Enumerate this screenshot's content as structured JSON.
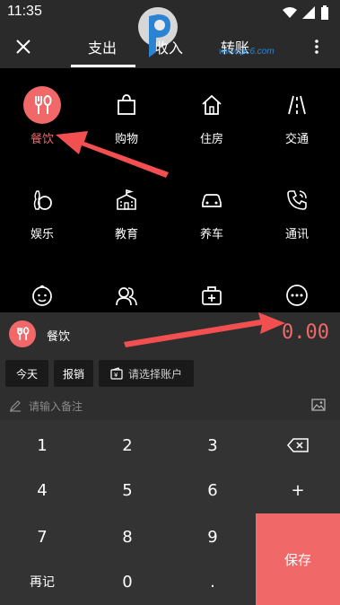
{
  "status": {
    "time": "11:35"
  },
  "header": {
    "tabs": [
      {
        "label": "支出",
        "active": true
      },
      {
        "label": "收入",
        "active": false
      },
      {
        "label": "转账",
        "active": false
      }
    ]
  },
  "watermark": {
    "text": "www.pc6.com"
  },
  "categories": [
    {
      "label": "餐饮",
      "icon": "fork-spoon-icon",
      "selected": true
    },
    {
      "label": "购物",
      "icon": "shopping-bag-icon",
      "selected": false
    },
    {
      "label": "住房",
      "icon": "house-icon",
      "selected": false
    },
    {
      "label": "交通",
      "icon": "road-icon",
      "selected": false
    },
    {
      "label": "娱乐",
      "icon": "bowling-icon",
      "selected": false
    },
    {
      "label": "教育",
      "icon": "school-icon",
      "selected": false
    },
    {
      "label": "养车",
      "icon": "car-icon",
      "selected": false
    },
    {
      "label": "通讯",
      "icon": "phone-icon",
      "selected": false
    },
    {
      "label": "",
      "icon": "baby-icon",
      "selected": false
    },
    {
      "label": "",
      "icon": "people-icon",
      "selected": false
    },
    {
      "label": "",
      "icon": "medical-kit-icon",
      "selected": false
    },
    {
      "label": "",
      "icon": "more-dots-icon",
      "selected": false
    }
  ],
  "entry": {
    "category": "餐饮",
    "amount": "0.00",
    "chips": {
      "date": "今天",
      "reimburse": "报销",
      "account": "请选择账户"
    },
    "note_placeholder": "请输入备注"
  },
  "keypad": {
    "keys": [
      "1",
      "2",
      "3",
      "4",
      "5",
      "6",
      "+",
      "7",
      "8",
      "9",
      "再记",
      "0",
      "."
    ],
    "save": "保存"
  },
  "colors": {
    "accent": "#f06868",
    "background": "#000000",
    "panel": "#2e2e2e"
  }
}
